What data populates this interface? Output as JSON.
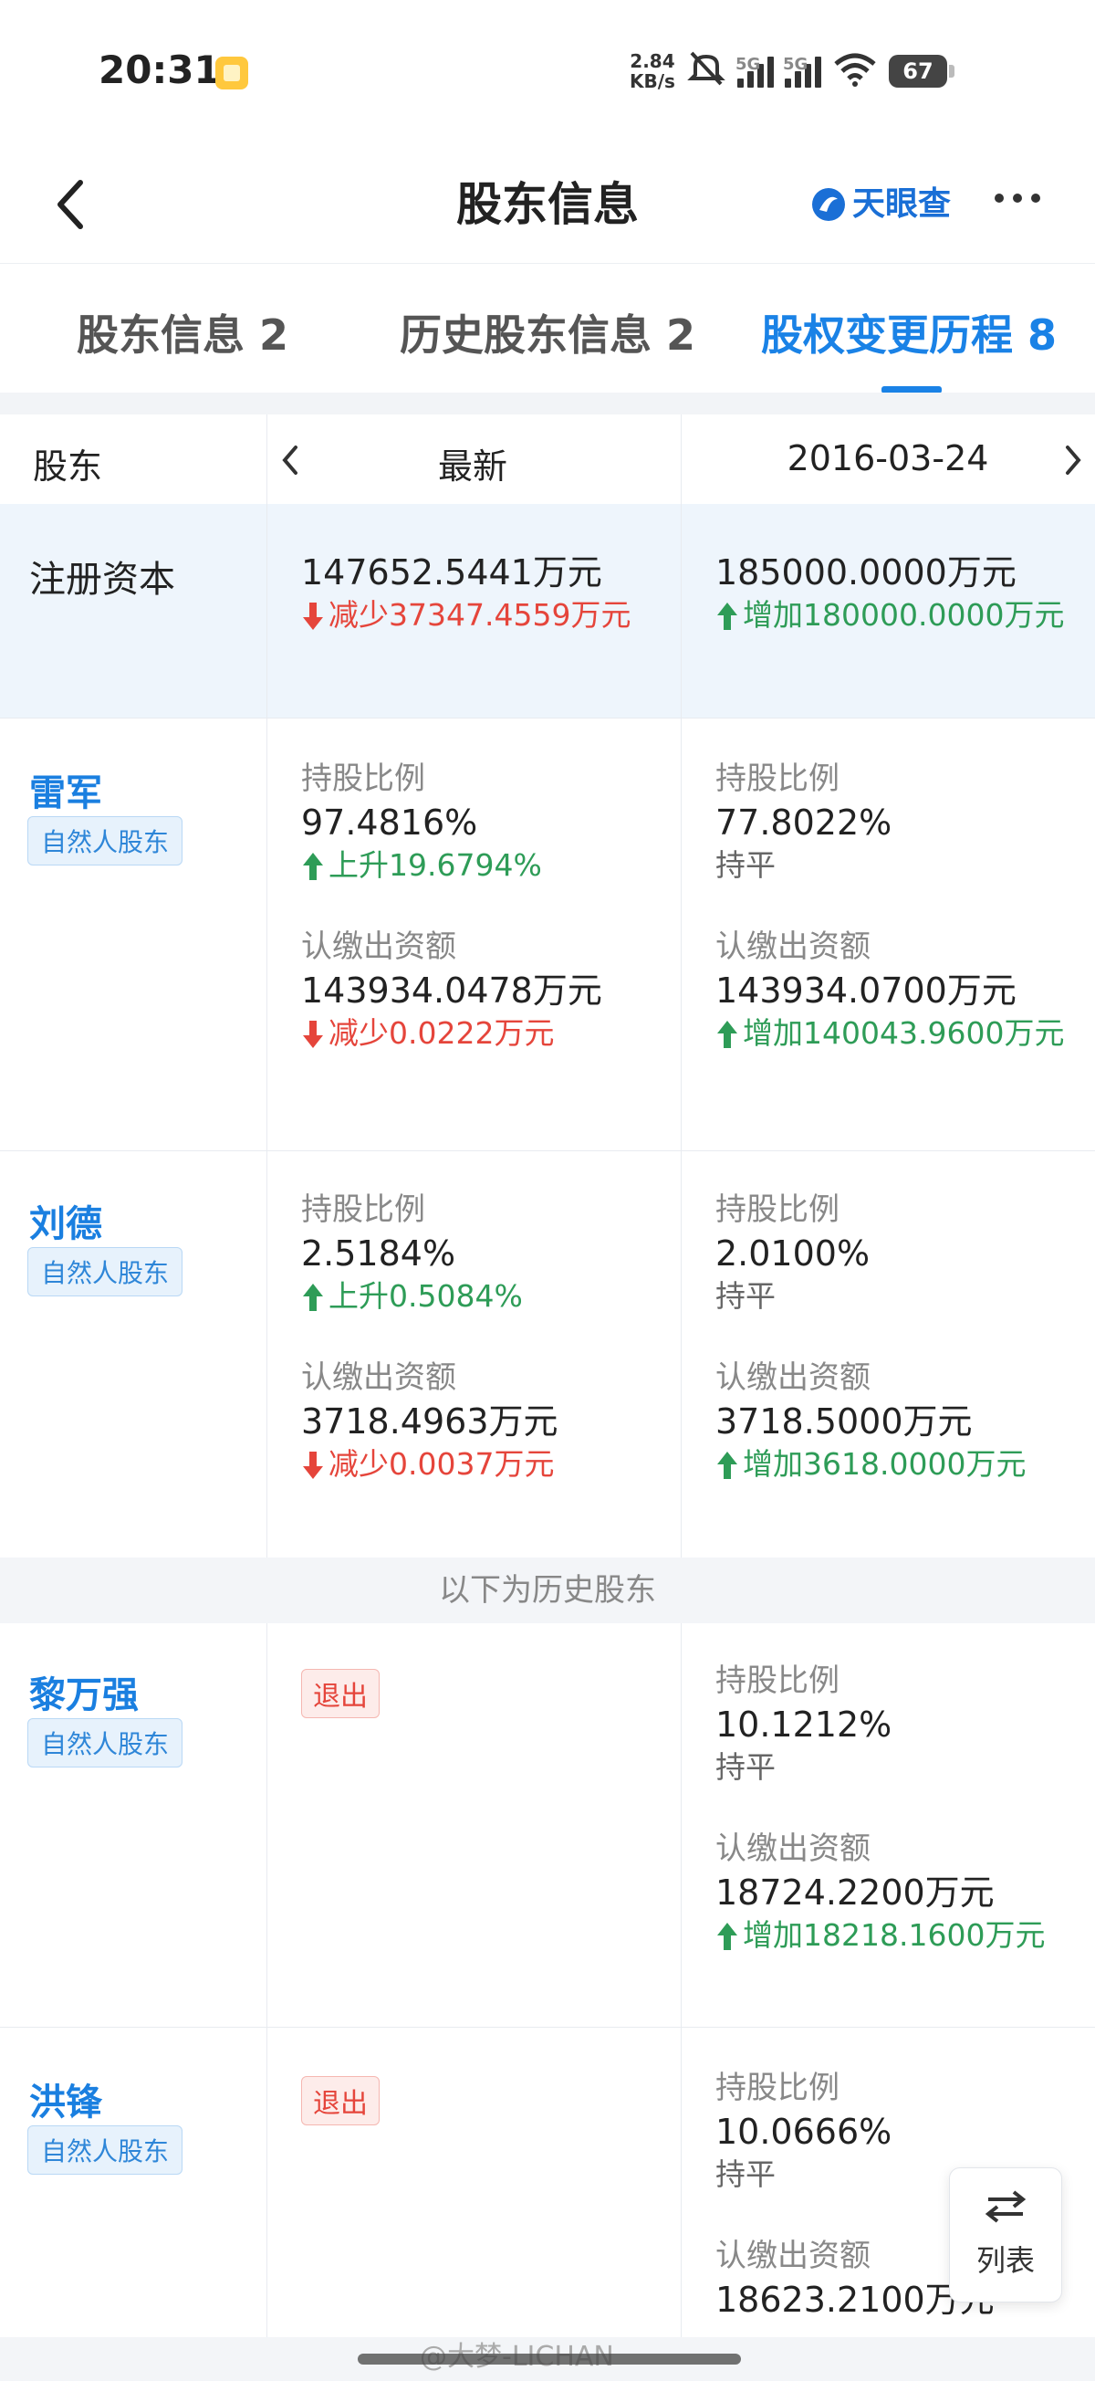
{
  "status_bar": {
    "time": "20:31",
    "net_speed_value": "2.84",
    "net_speed_unit": "KB/s",
    "signal1_label": "5G",
    "signal2_label": "5G",
    "battery": "67"
  },
  "nav": {
    "title": "股东信息",
    "brand": "天眼查"
  },
  "tabs": [
    {
      "label": "股东信息 2"
    },
    {
      "label": "历史股东信息 2"
    },
    {
      "label": "股权变更历程 8"
    }
  ],
  "table_header": {
    "col1": "股东",
    "col2": "最新",
    "col3": "2016-03-24"
  },
  "capital": {
    "label": "注册资本",
    "latest_value": "147652.5441万元",
    "latest_change": "减少37347.4559万元",
    "prev_value": "185000.0000万元",
    "prev_change": "增加180000.0000万元"
  },
  "shareholders": [
    {
      "name": "雷军",
      "tag": "自然人股东",
      "latest": {
        "ratio_label": "持股比例",
        "ratio": "97.4816%",
        "ratio_change": "上升19.6794%",
        "capital_label": "认缴出资额",
        "capital": "143934.0478万元",
        "capital_change": "减少0.0222万元"
      },
      "prev": {
        "ratio_label": "持股比例",
        "ratio": "77.8022%",
        "ratio_change": "持平",
        "capital_label": "认缴出资额",
        "capital": "143934.0700万元",
        "capital_change": "增加140043.9600万元"
      }
    },
    {
      "name": "刘德",
      "tag": "自然人股东",
      "latest": {
        "ratio_label": "持股比例",
        "ratio": "2.5184%",
        "ratio_change": "上升0.5084%",
        "capital_label": "认缴出资额",
        "capital": "3718.4963万元",
        "capital_change": "减少0.0037万元"
      },
      "prev": {
        "ratio_label": "持股比例",
        "ratio": "2.0100%",
        "ratio_change": "持平",
        "capital_label": "认缴出资额",
        "capital": "3718.5000万元",
        "capital_change": "增加3618.0000万元"
      }
    }
  ],
  "history_divider": "以下为历史股东",
  "history_shareholders": [
    {
      "name": "黎万强",
      "tag": "自然人股东",
      "latest_status": "退出",
      "prev": {
        "ratio_label": "持股比例",
        "ratio": "10.1212%",
        "ratio_change": "持平",
        "capital_label": "认缴出资额",
        "capital": "18724.2200万元",
        "capital_change": "增加18218.1600万元"
      }
    },
    {
      "name": "洪锋",
      "tag": "自然人股东",
      "latest_status": "退出",
      "prev": {
        "ratio_label": "持股比例",
        "ratio": "10.0666%",
        "ratio_change": "持平",
        "capital_label": "认缴出资额",
        "capital": "18623.2100万元"
      }
    }
  ],
  "float_button": {
    "label": "列表",
    "icon": "swap-arrows-icon"
  },
  "watermark": "@大梦-LICHAN",
  "colors": {
    "accent": "#1a82e6",
    "decrease": "#e5453b",
    "increase": "#2e9c57"
  }
}
